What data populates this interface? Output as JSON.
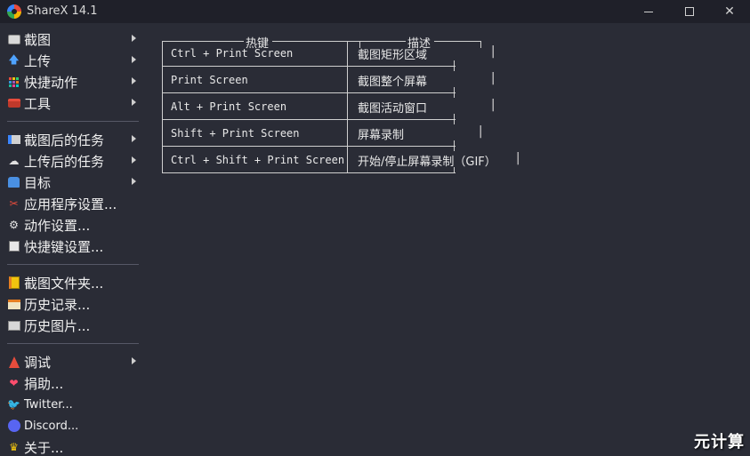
{
  "window": {
    "title": "ShareX 14.1"
  },
  "menu": {
    "group1": [
      {
        "label": "截图",
        "icon": "capture-icon",
        "submenu": true
      },
      {
        "label": "上传",
        "icon": "upload-arrow-icon",
        "submenu": true
      },
      {
        "label": "快捷动作",
        "icon": "dots-grid-icon",
        "submenu": true
      },
      {
        "label": "工具",
        "icon": "toolbox-icon",
        "submenu": true
      }
    ],
    "group2": [
      {
        "label": "截图后的任务",
        "icon": "after-capture-icon",
        "submenu": true
      },
      {
        "label": "上传后的任务",
        "icon": "after-upload-icon",
        "submenu": true
      },
      {
        "label": "目标",
        "icon": "destination-icon",
        "submenu": true
      },
      {
        "label": "应用程序设置...",
        "icon": "app-settings-icon",
        "submenu": false
      },
      {
        "label": "动作设置...",
        "icon": "gear-icon",
        "submenu": false
      },
      {
        "label": "快捷键设置...",
        "icon": "hotkey-icon",
        "submenu": false
      }
    ],
    "group3": [
      {
        "label": "截图文件夹...",
        "icon": "folder-icon",
        "submenu": false
      },
      {
        "label": "历史记录...",
        "icon": "history-icon",
        "submenu": false
      },
      {
        "label": "历史图片...",
        "icon": "image-history-icon",
        "submenu": false
      }
    ],
    "group4": [
      {
        "label": "调试",
        "icon": "debug-icon",
        "submenu": true
      },
      {
        "label": "捐助...",
        "icon": "heart-icon",
        "submenu": false
      },
      {
        "label": "Twitter...",
        "icon": "twitter-icon",
        "submenu": false
      },
      {
        "label": "Discord...",
        "icon": "discord-icon",
        "submenu": false
      },
      {
        "label": "关于...",
        "icon": "crown-icon",
        "submenu": false
      }
    ]
  },
  "hotkeys": {
    "header_key": "热键",
    "header_desc": "描述",
    "rows": [
      {
        "key": "Ctrl + Print Screen",
        "desc": "截图矩形区域"
      },
      {
        "key": "Print Screen",
        "desc": "截图整个屏幕"
      },
      {
        "key": "Alt + Print Screen",
        "desc": "截图活动窗口"
      },
      {
        "key": "Shift + Print Screen",
        "desc": "屏幕录制"
      },
      {
        "key": "Ctrl + Shift + Print Screen",
        "desc": "开始/停止屏幕录制（GIF）"
      }
    ]
  },
  "watermark": "元计算"
}
